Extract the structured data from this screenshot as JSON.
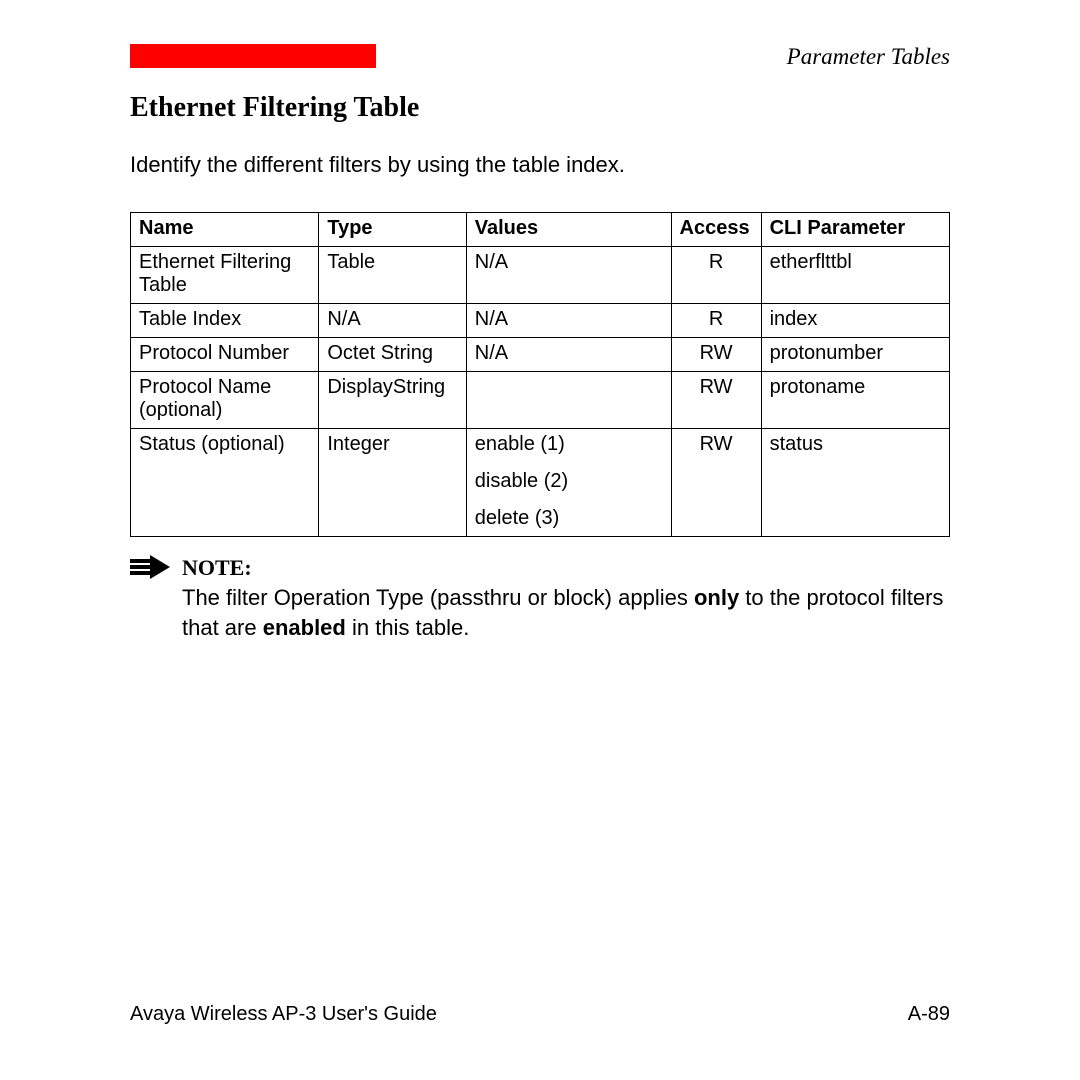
{
  "header": {
    "section": "Parameter Tables"
  },
  "title": "Ethernet Filtering Table",
  "intro": "Identify the different filters by using the table index.",
  "table": {
    "headers": {
      "name": "Name",
      "type": "Type",
      "values": "Values",
      "access": "Access",
      "cli": "CLI Parameter"
    },
    "rows": [
      {
        "name": "Ethernet Filtering Table",
        "type": "Table",
        "values": "N/A",
        "access": "R",
        "cli": "etherflttbl"
      },
      {
        "name": "Table Index",
        "type": "N/A",
        "values": "N/A",
        "access": "R",
        "cli": "index"
      },
      {
        "name": "Protocol Number",
        "type": "Octet String",
        "values": "N/A",
        "access": "RW",
        "cli": "protonumber"
      },
      {
        "name": "Protocol Name (optional)",
        "type": "DisplayString",
        "values": "",
        "access": "RW",
        "cli": "protoname"
      },
      {
        "name": "Status (optional)",
        "type": "Integer",
        "values_multi": [
          "enable (1)",
          "disable (2)",
          "delete (3)"
        ],
        "access": "RW",
        "cli": "status"
      }
    ]
  },
  "note": {
    "label": "NOTE:",
    "text_parts": {
      "p1": "The filter Operation Type (passthru or block) applies ",
      "b1": "only",
      "p2": " to the protocol filters that are ",
      "b2": "enabled",
      "p3": " in this table."
    }
  },
  "footer": {
    "left": "Avaya Wireless AP-3 User's Guide",
    "right": "A-89"
  }
}
